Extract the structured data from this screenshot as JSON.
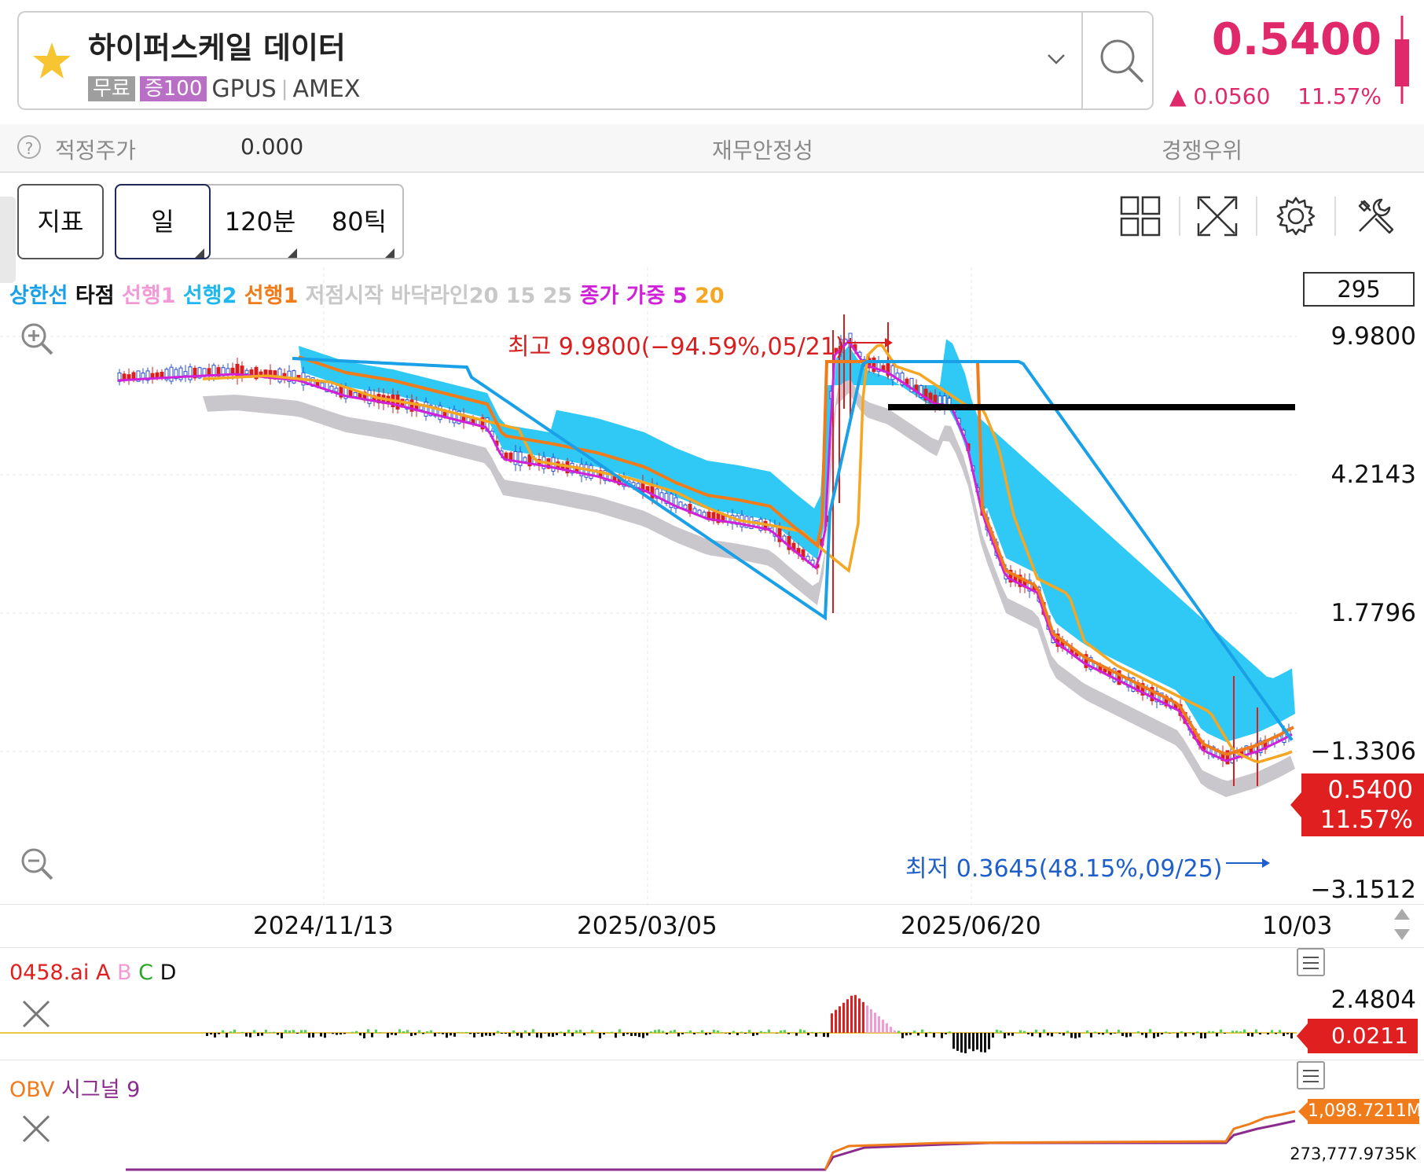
{
  "header": {
    "stock_name": "하이퍼스케일 데이터",
    "tag_free": "무료",
    "tag_margin": "증100",
    "ticker": "GPUS",
    "separator": "|",
    "exchange": "AMEX",
    "price": "0.5400",
    "change": "▲ 0.0560",
    "change_pct": "11.57%",
    "accent_color": "#e0296b"
  },
  "info_bar": {
    "help": "?",
    "fair_price_label": "적정주가",
    "fair_price_value": "0.000",
    "financial_label": "재무안정성",
    "competitive_label": "경쟁우위"
  },
  "toolbar": {
    "indicator_label": "지표",
    "periods": [
      "일",
      "120분",
      "80틱"
    ],
    "selected_period": "일",
    "tools": [
      "layout-grid-icon",
      "fullscreen-icon",
      "gear-icon",
      "tools-icon"
    ]
  },
  "chart": {
    "legend": [
      {
        "text": "상한선",
        "color": "#1aa0e6"
      },
      {
        "text": "타점",
        "color": "#111111"
      },
      {
        "text": "선행1",
        "color": "#f29ad6"
      },
      {
        "text": "선행2",
        "color": "#1fb8ee"
      },
      {
        "text": "선행1",
        "color": "#f07b1a"
      },
      {
        "text": "저점시작",
        "color": "#c8c8c8"
      },
      {
        "text": "바닥라인20",
        "color": "#c8c8c8"
      },
      {
        "text": "15",
        "color": "#c8c8c8"
      },
      {
        "text": "25",
        "color": "#c8c8c8"
      },
      {
        "text": "종가 가중",
        "color": "#d020d8"
      },
      {
        "text": "5",
        "color": "#d020d8"
      },
      {
        "text": "20",
        "color": "#f5a623"
      }
    ],
    "count": "295",
    "high_annotation": "최고 9.9800(−94.59%,05/21)",
    "low_annotation": "최저 0.3645(48.15%,09/25)",
    "y_labels": [
      "9.9800",
      "4.2143",
      "1.7796",
      "−1.3306",
      "−3.1512"
    ],
    "price_tag_value": "0.5400",
    "price_tag_pct": "11.57%",
    "x_labels": [
      "2024/11/13",
      "2025/03/05",
      "2025/06/20",
      "10/03"
    ]
  },
  "panel_ai": {
    "name": "0458.ai",
    "series": [
      {
        "text": "A",
        "color": "#e02020"
      },
      {
        "text": "B",
        "color": "#f29ad6"
      },
      {
        "text": "C",
        "color": "#2aa52a"
      },
      {
        "text": "D",
        "color": "#111111"
      }
    ],
    "y_label": "2.4804",
    "tag_value": "0.0211"
  },
  "panel_obv": {
    "name": "OBV",
    "signal": "시그널 9",
    "tag_value": "1,098.7211M",
    "bottom_value": "273,777.9735K"
  },
  "chart_data": {
    "type": "line",
    "title": "",
    "x_ticks": [
      "2024/11/13",
      "2025/03/05",
      "2025/06/20",
      "10/03"
    ],
    "y_ticks": [
      "9.9800",
      "4.2143",
      "1.7796",
      "−1.3306",
      "−3.1512"
    ],
    "series": [
      {
        "name": "종가 가중 5",
        "color": "#d020d8"
      },
      {
        "name": "20",
        "color": "#f5a623"
      },
      {
        "name": "상한선",
        "color": "#1aa0e6"
      },
      {
        "name": "선행1",
        "color": "#f07b1a"
      }
    ],
    "high": {
      "value": 9.98,
      "date": "05/21"
    },
    "low": {
      "value": 0.3645,
      "date": "09/25"
    },
    "last": 0.54
  }
}
